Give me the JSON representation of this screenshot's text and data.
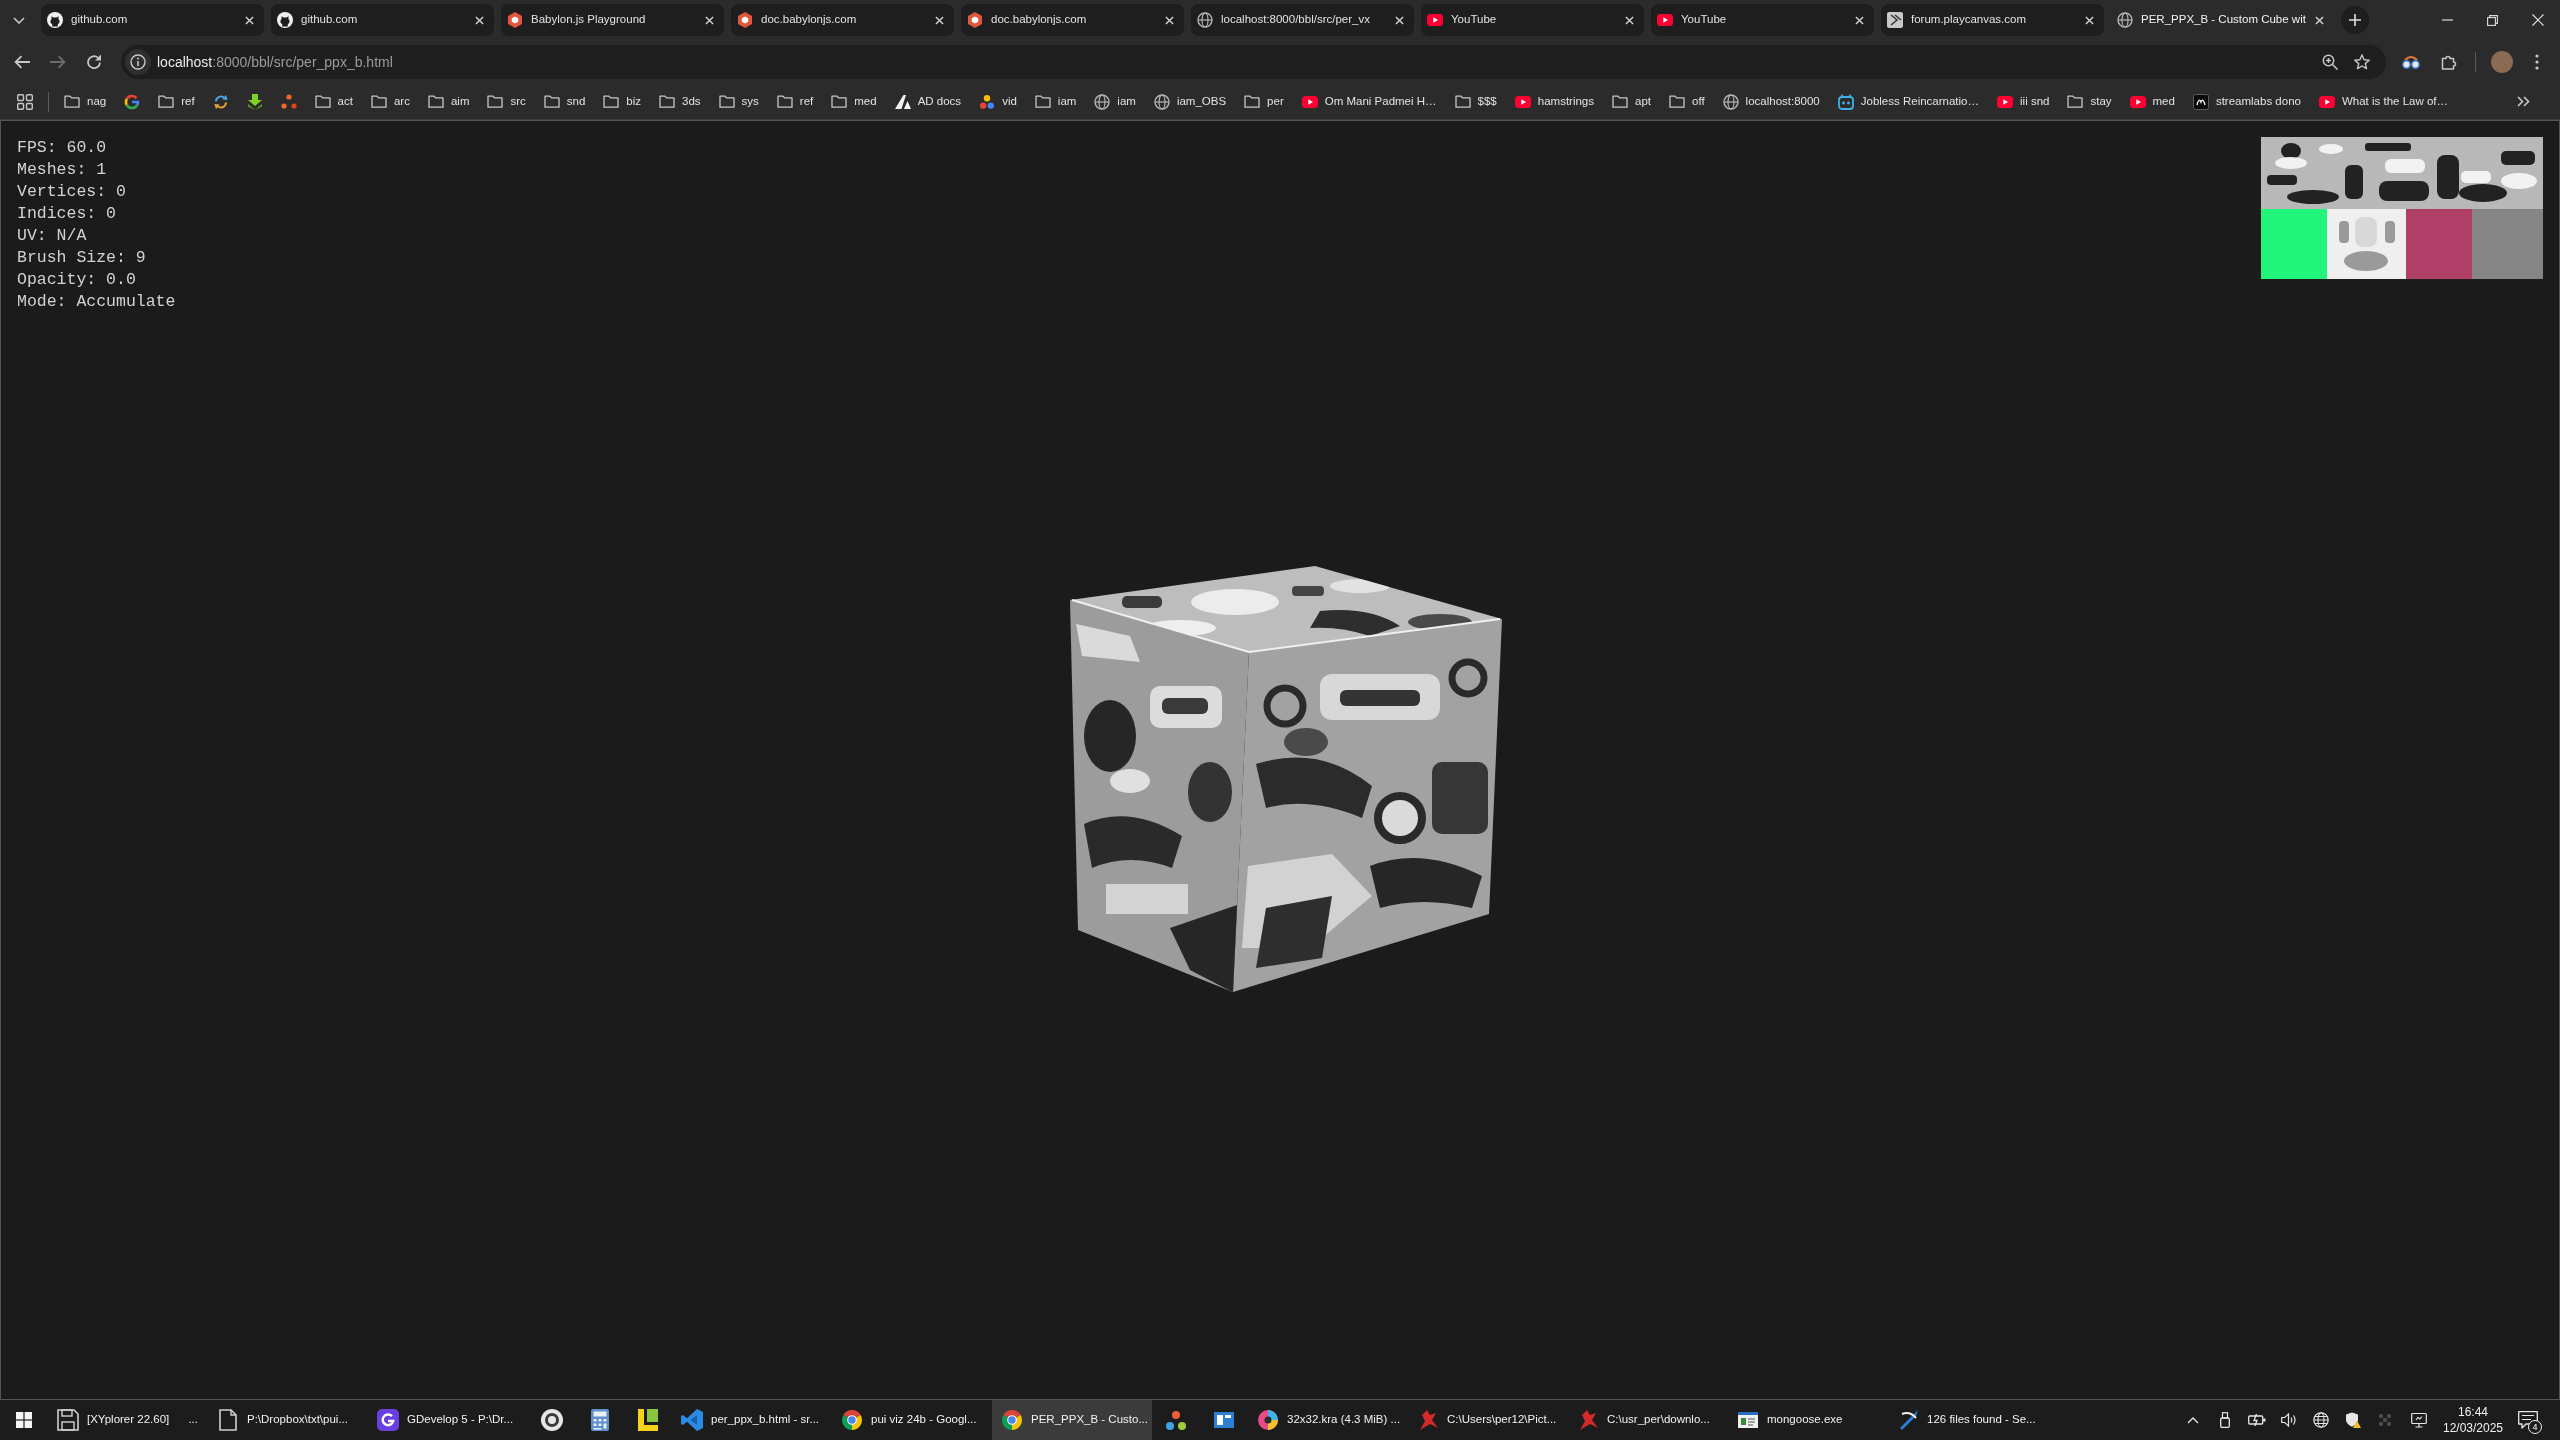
{
  "browser": {
    "tabs": [
      {
        "kind": "cat",
        "title": "github.com",
        "selected": false
      },
      {
        "kind": "cat",
        "title": "github.com",
        "selected": false
      },
      {
        "kind": "hexagon",
        "title": "Babylon.js Playground",
        "selected": false
      },
      {
        "kind": "hexagon",
        "title": "doc.babylonjs.com",
        "selected": false
      },
      {
        "kind": "hexagon",
        "title": "doc.babylonjs.com",
        "selected": false
      },
      {
        "kind": "globe",
        "title": "localhost:8000/bbl/src/per_vx",
        "selected": false
      },
      {
        "kind": "play",
        "title": "YouTube",
        "selected": false
      },
      {
        "kind": "play",
        "title": "YouTube",
        "selected": false
      },
      {
        "kind": "tile",
        "title": "forum.playcanvas.com",
        "selected": false
      },
      {
        "kind": "globe",
        "title": "PER_PPX_B - Custom Cube wit",
        "selected": true
      }
    ],
    "address": {
      "host": "localhost",
      "path": ":8000/bbl/src/per_ppx_b.html"
    },
    "bookmarks": [
      {
        "kind": "folder",
        "label": "nag"
      },
      {
        "kind": "g-logo"
      },
      {
        "kind": "folder",
        "label": "ref"
      },
      {
        "kind": "arrows"
      },
      {
        "kind": "down-arrow"
      },
      {
        "kind": "dots"
      },
      {
        "kind": "folder",
        "label": "act"
      },
      {
        "kind": "folder",
        "label": "arc"
      },
      {
        "kind": "folder",
        "label": "aim"
      },
      {
        "kind": "folder",
        "label": "src"
      },
      {
        "kind": "folder",
        "label": "snd"
      },
      {
        "kind": "folder",
        "label": "biz"
      },
      {
        "kind": "folder",
        "label": "3ds"
      },
      {
        "kind": "folder",
        "label": "sys"
      },
      {
        "kind": "folder",
        "label": "ref"
      },
      {
        "kind": "folder",
        "label": "med"
      },
      {
        "kind": "sail",
        "label": "AD docs"
      },
      {
        "kind": "color-dots",
        "label": "vid"
      },
      {
        "kind": "folder",
        "label": "iam"
      },
      {
        "kind": "globe",
        "label": "iam"
      },
      {
        "kind": "globe",
        "label": "iam_OBS"
      },
      {
        "kind": "folder",
        "label": "per"
      },
      {
        "kind": "play",
        "label": "Om Mani Padmei H…"
      },
      {
        "kind": "folder",
        "label": "$$$"
      },
      {
        "kind": "play",
        "label": "hamstrings"
      },
      {
        "kind": "folder",
        "label": "apt"
      },
      {
        "kind": "folder",
        "label": "off"
      },
      {
        "kind": "globe",
        "label": "localhost:8000"
      },
      {
        "kind": "robot",
        "label": "Jobless Reincarnatio…"
      },
      {
        "kind": "play",
        "label": "iii snd"
      },
      {
        "kind": "folder",
        "label": "stay"
      },
      {
        "kind": "play",
        "label": "med"
      },
      {
        "kind": "dark-tile",
        "label": "streamlabs dono"
      },
      {
        "kind": "play",
        "label": "What is the Law of…"
      }
    ]
  },
  "scene": {
    "stats": [
      "FPS: 60.0",
      "Meshes: 1",
      "Vertices: 0",
      "Indices: 0",
      "UV: N/A",
      "Brush Size: 9",
      "Opacity: 0.0",
      "Mode: Accumulate"
    ]
  },
  "taskbar": {
    "items": [
      {
        "kind": "floppy",
        "label": "[XYplorer 22.60]",
        "more": "...",
        "selected": false
      },
      {
        "kind": "page",
        "label": "P:\\Dropbox\\txt\\pui...",
        "selected": false
      },
      {
        "kind": "g-tile",
        "label": "GDevelop 5 - P:\\Dr...",
        "selected": false
      },
      {
        "kind": "ring",
        "selected": false
      },
      {
        "kind": "calculator",
        "selected": false
      },
      {
        "kind": "blocks",
        "selected": false
      },
      {
        "kind": "ribbon",
        "label": "per_ppx_b.html - sr...",
        "selected": false
      },
      {
        "kind": "browser",
        "label": "pui viz 24b - Googl...",
        "selected": false
      },
      {
        "kind": "browser",
        "label": "PER_PPX_B - Custo...",
        "selected": true
      },
      {
        "kind": "dots",
        "selected": false
      },
      {
        "kind": "panel",
        "selected": false
      },
      {
        "kind": "paint",
        "label": "32x32.kra (4.3 MiB) ...",
        "selected": false
      },
      {
        "kind": "figure",
        "label": "C:\\Users\\per12\\Pict...",
        "selected": false
      },
      {
        "kind": "figure",
        "label": "C:\\usr_per\\downlo...",
        "selected": false
      },
      {
        "kind": "app-window",
        "label": "mongoose.exe",
        "selected": false
      },
      {
        "kind": "blade",
        "label": "126 files found - Se...",
        "selected": false
      }
    ],
    "clock": {
      "time": "16:44",
      "date": "12/03/2025"
    },
    "notification_count": "4"
  }
}
